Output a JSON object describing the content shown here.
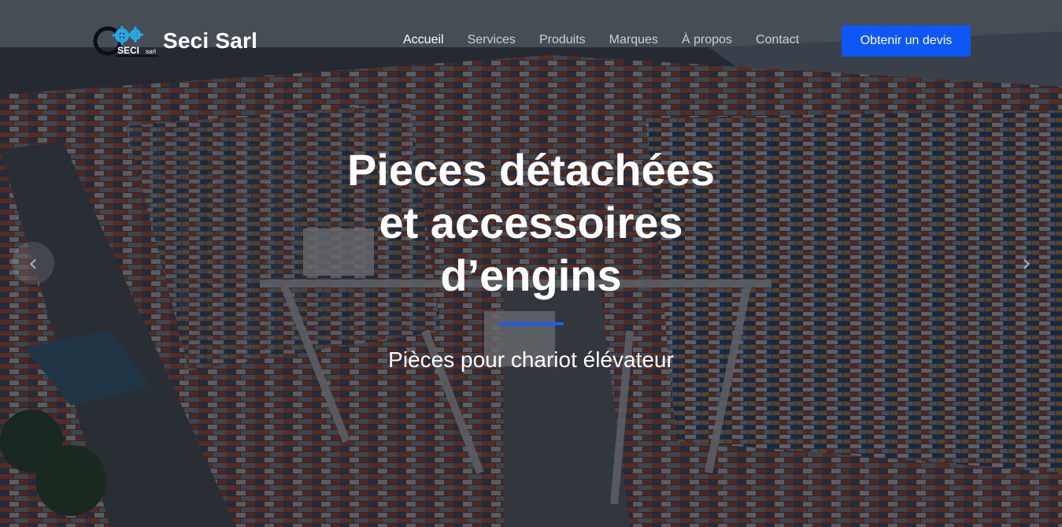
{
  "brand": {
    "name": "Seci Sarl",
    "logo_text": "SECI",
    "logo_subtext": "sarl"
  },
  "nav": {
    "items": [
      {
        "label": "Accueil",
        "active": true
      },
      {
        "label": "Services",
        "active": false
      },
      {
        "label": "Produits",
        "active": false
      },
      {
        "label": "Marques",
        "active": false
      },
      {
        "label": "À propos",
        "active": false
      },
      {
        "label": "Contact",
        "active": false
      }
    ],
    "cta_label": "Obtenir un devis"
  },
  "hero": {
    "title_lines": [
      "Pieces détachées",
      "et accessoires",
      "d’engins"
    ],
    "subtitle": "Pièces pour chariot élévateur"
  },
  "carousel": {
    "prev_icon": "chevron-left-icon",
    "next_icon": "chevron-right-icon"
  },
  "colors": {
    "accent": "#0d57f5",
    "divider": "#1f5df0",
    "logo_blue": "#2aa7e6"
  }
}
